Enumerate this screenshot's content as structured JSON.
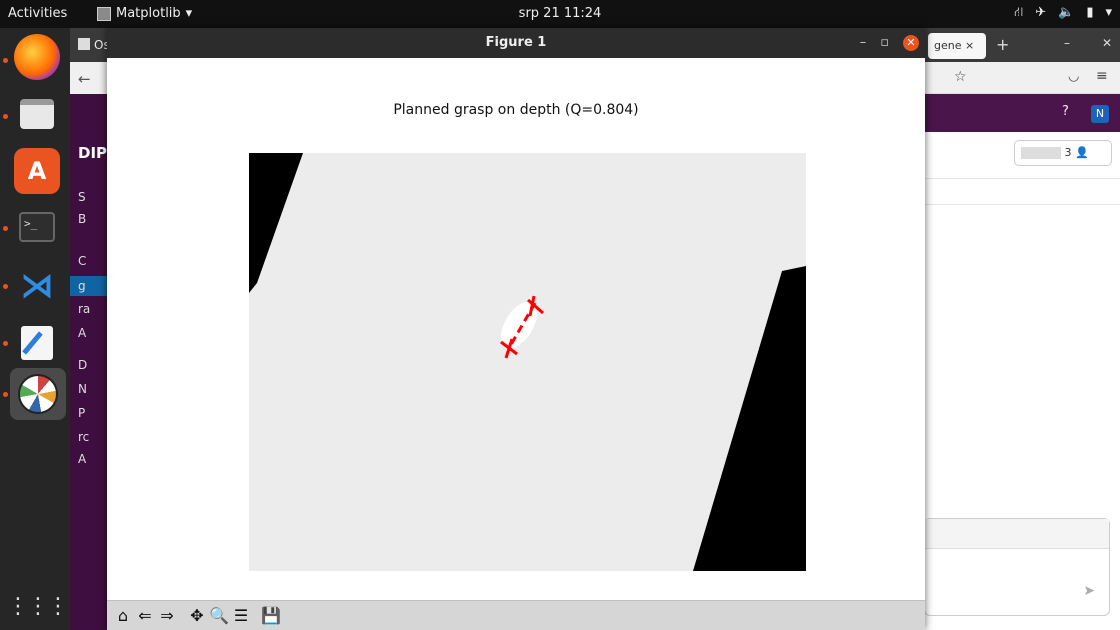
{
  "topbar": {
    "activities": "Activities",
    "app_menu": "Matplotlib",
    "clock": "srp 21  11:24",
    "tray_icons": [
      "network-icon",
      "airplane-icon",
      "volume-icon",
      "battery-icon",
      "system-menu-icon"
    ]
  },
  "dock": {
    "items": [
      "firefox",
      "files",
      "app-store",
      "terminal",
      "vscode",
      "text-editor",
      "matplotlib-figure",
      "show-apps"
    ]
  },
  "background_left": {
    "tab_partial": "Os",
    "workspace_partial": "DIPI",
    "channels": [
      "S",
      "B",
      "C",
      "g",
      "ra",
      "A",
      "D",
      "N",
      "P",
      "rc",
      "A"
    ]
  },
  "background_right": {
    "tab_partial": "gene",
    "member_count": "3"
  },
  "figure": {
    "window_title": "Figure 1",
    "plot_title": "Planned grasp on depth (Q=0.804)",
    "toolbar": {
      "home": "home-icon",
      "back": "back-arrow-icon",
      "forward": "forward-arrow-icon",
      "pan": "pan-icon",
      "zoom": "zoom-icon",
      "configure": "configure-subplots-icon",
      "save": "save-icon"
    },
    "colors": {
      "grasp": "#ff0000",
      "depth_background": "#ececec",
      "depth_shadow": "#000000"
    }
  }
}
